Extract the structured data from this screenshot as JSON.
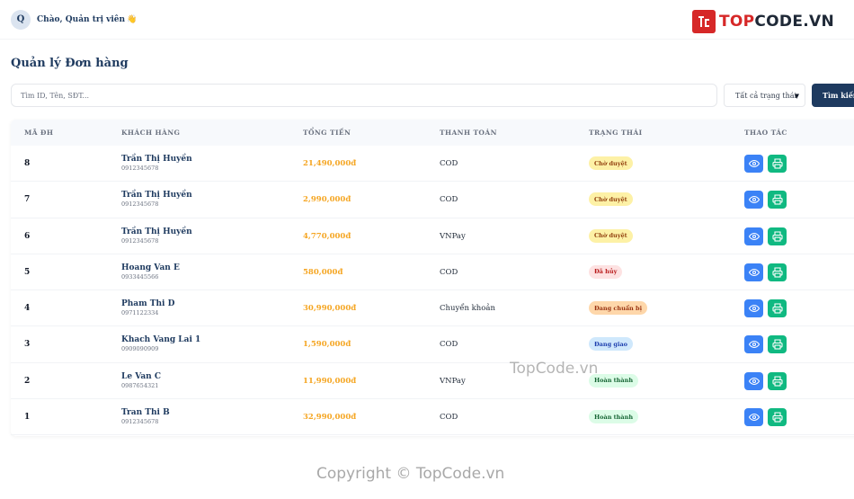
{
  "header": {
    "avatar_letter": "Q",
    "greeting": "Chào, Quản trị viên",
    "wave": "👋"
  },
  "brand": {
    "name_prefix": "TOP",
    "name_suffix": "CODE.VN"
  },
  "page": {
    "title": "Quản lý Đơn hàng"
  },
  "search": {
    "placeholder": "Tìm ID, Tên, SĐT...",
    "status_selected": "Tất cả trạng thái",
    "button_label": "Tìm kiếm"
  },
  "table": {
    "columns": [
      "MÃ ĐH",
      "KHÁCH HÀNG",
      "TỔNG TIỀN",
      "THANH TOÁN",
      "TRẠNG THÁI",
      "THAO TÁC"
    ],
    "rows": [
      {
        "id": "8",
        "name": "Trần Thị Huyền",
        "phone": "0912345678",
        "total": "21,490,000đ",
        "payment": "COD",
        "status": "Chờ duyệt",
        "status_type": "pending"
      },
      {
        "id": "7",
        "name": "Trần Thị Huyền",
        "phone": "0912345678",
        "total": "2,990,000đ",
        "payment": "COD",
        "status": "Chờ duyệt",
        "status_type": "pending"
      },
      {
        "id": "6",
        "name": "Trần Thị Huyền",
        "phone": "0912345678",
        "total": "4,770,000đ",
        "payment": "VNPay",
        "status": "Chờ duyệt",
        "status_type": "pending"
      },
      {
        "id": "5",
        "name": "Hoang Van E",
        "phone": "0933445566",
        "total": "580,000đ",
        "payment": "COD",
        "status": "Đã hủy",
        "status_type": "cancelled"
      },
      {
        "id": "4",
        "name": "Pham Thi D",
        "phone": "0971122334",
        "total": "30,990,000đ",
        "payment": "Chuyển khoản",
        "status": "Đang chuẩn bị",
        "status_type": "preparing"
      },
      {
        "id": "3",
        "name": "Khach Vang Lai 1",
        "phone": "0909090909",
        "total": "1,590,000đ",
        "payment": "COD",
        "status": "Đang giao",
        "status_type": "shipping"
      },
      {
        "id": "2",
        "name": "Le Van C",
        "phone": "0987654321",
        "total": "11,990,000đ",
        "payment": "VNPay",
        "status": "Hoàn thành",
        "status_type": "done"
      },
      {
        "id": "1",
        "name": "Tran Thi B",
        "phone": "0912345678",
        "total": "32,990,000đ",
        "payment": "COD",
        "status": "Hoàn thành",
        "status_type": "done"
      }
    ]
  },
  "status_colors": {
    "pending": {
      "bg": "#fdf1a6",
      "fg": "#92400e"
    },
    "cancelled": {
      "bg": "#fde2e2",
      "fg": "#b91c1c"
    },
    "preparing": {
      "bg": "#fed7aa",
      "fg": "#9a3412"
    },
    "shipping": {
      "bg": "#cfe8fc",
      "fg": "#1e40af"
    },
    "done": {
      "bg": "#dcfce7",
      "fg": "#166534"
    }
  },
  "icons": {
    "view": "eye-icon",
    "print": "printer-icon"
  },
  "watermarks": {
    "middle": "TopCode.vn",
    "bottom": "Copyright © TopCode.vn"
  }
}
